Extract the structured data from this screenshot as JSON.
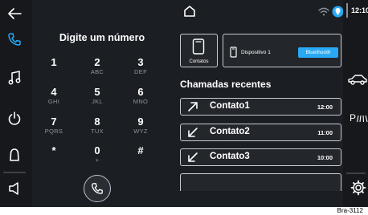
{
  "status_bar": {
    "time": "12:10",
    "icons": [
      "home-icon",
      "wifi-icon",
      "location-icon"
    ]
  },
  "left_nav": {
    "items": [
      {
        "name": "back-icon"
      },
      {
        "name": "phone-icon",
        "active": true
      },
      {
        "name": "music-icon"
      },
      {
        "name": "power-icon"
      },
      {
        "name": "alert-bell-icon"
      },
      {
        "name": "volume-icon"
      }
    ]
  },
  "right_nav": {
    "items": [
      {
        "name": "car-icon"
      },
      {
        "name": "parking-icon",
        "label": "P"
      },
      {
        "name": "settings-gear-icon"
      }
    ]
  },
  "dialpad": {
    "title": "Digite um número",
    "keys": [
      {
        "digit": "1",
        "letters": ""
      },
      {
        "digit": "2",
        "letters": "ABC"
      },
      {
        "digit": "3",
        "letters": "DEF"
      },
      {
        "digit": "4",
        "letters": "GHI"
      },
      {
        "digit": "5",
        "letters": "JKL"
      },
      {
        "digit": "6",
        "letters": "MNO"
      },
      {
        "digit": "7",
        "letters": "PQRS"
      },
      {
        "digit": "8",
        "letters": "TUX"
      },
      {
        "digit": "9",
        "letters": "WYZ"
      },
      {
        "digit": "*",
        "letters": ""
      },
      {
        "digit": "0",
        "letters": "+"
      },
      {
        "digit": "#",
        "letters": ""
      }
    ]
  },
  "contacts_tile": {
    "label": "Contatos"
  },
  "device": {
    "name": "Dispositivo 1",
    "connection": "Bluethooth"
  },
  "recent_calls": {
    "title": "Chamadas recentes",
    "items": [
      {
        "name": "Contato1",
        "time": "12:00",
        "direction": "outgoing"
      },
      {
        "name": "Contato2",
        "time": "11:00",
        "direction": "incoming"
      },
      {
        "name": "Contato3",
        "time": "10:00",
        "direction": "incoming"
      }
    ]
  },
  "figure_label": "Bra-3112",
  "colors": {
    "accent": "#29a9f4",
    "background": "#1b1e23",
    "sidebar": "#16181c",
    "border": "#c8ccd3"
  }
}
